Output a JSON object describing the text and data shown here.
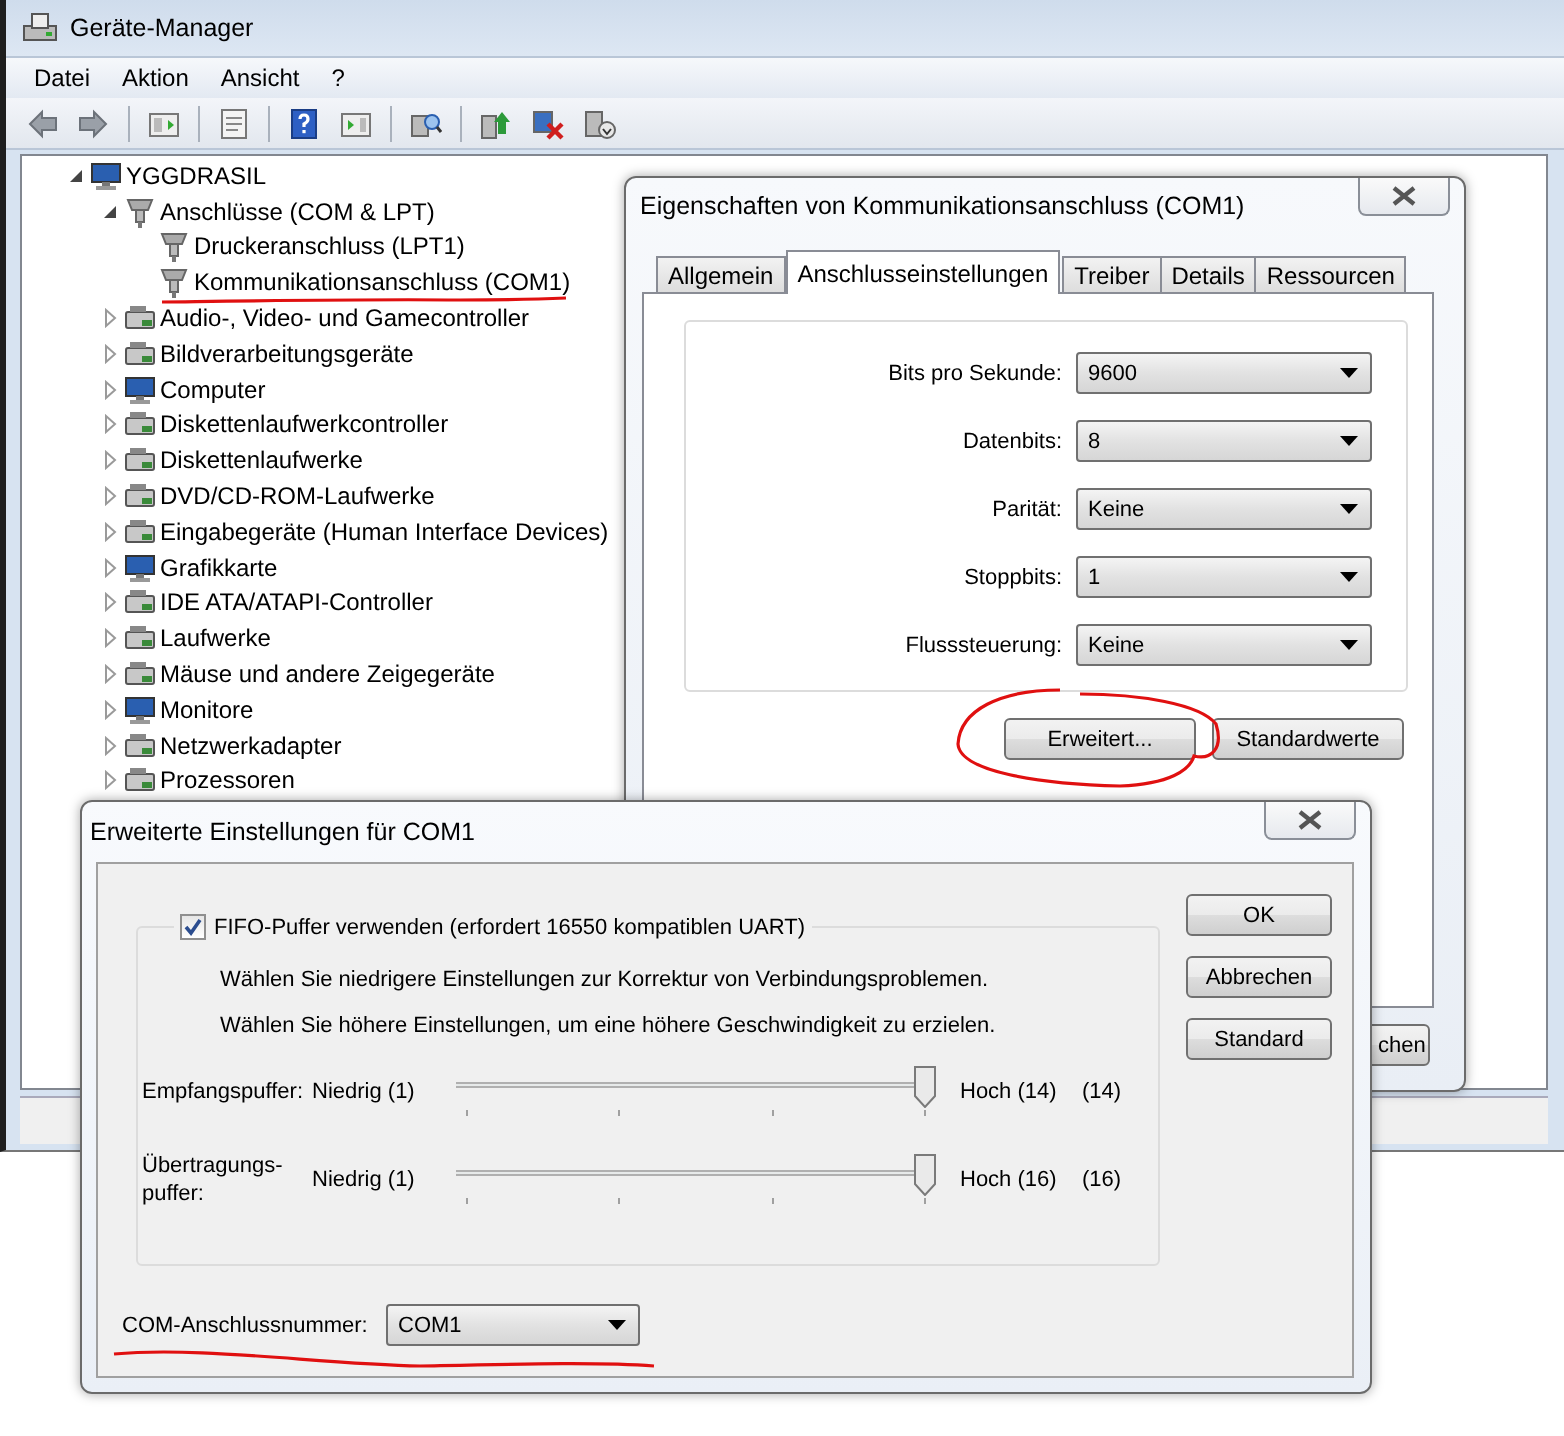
{
  "main_window": {
    "title": "Geräte-Manager",
    "menu": [
      "Datei",
      "Aktion",
      "Ansicht",
      "?"
    ],
    "tree": [
      {
        "label": "YGGDRASIL",
        "kind": "computer",
        "expanded": true,
        "children": [
          {
            "label": "Anschlüsse (COM & LPT)",
            "kind": "port",
            "expanded": true,
            "children": [
              {
                "label": "Druckeranschluss (LPT1)",
                "kind": "port"
              },
              {
                "label": "Kommunikationsanschluss (COM1)",
                "kind": "port"
              }
            ]
          },
          {
            "label": "Audio-, Video- und Gamecontroller",
            "kind": "device",
            "expanded": false
          },
          {
            "label": "Bildverarbeitungsgeräte",
            "kind": "device",
            "expanded": false
          },
          {
            "label": "Computer",
            "kind": "computer",
            "expanded": false
          },
          {
            "label": "Diskettenlaufwerkcontroller",
            "kind": "device",
            "expanded": false
          },
          {
            "label": "Diskettenlaufwerke",
            "kind": "device",
            "expanded": false
          },
          {
            "label": "DVD/CD-ROM-Laufwerke",
            "kind": "device",
            "expanded": false
          },
          {
            "label": "Eingabegeräte (Human Interface Devices)",
            "kind": "device",
            "expanded": false
          },
          {
            "label": "Grafikkarte",
            "kind": "computer",
            "expanded": false
          },
          {
            "label": "IDE ATA/ATAPI-Controller",
            "kind": "device",
            "expanded": false
          },
          {
            "label": "Laufwerke",
            "kind": "device",
            "expanded": false
          },
          {
            "label": "Mäuse und andere Zeigegeräte",
            "kind": "device",
            "expanded": false
          },
          {
            "label": "Monitore",
            "kind": "computer",
            "expanded": false
          },
          {
            "label": "Netzwerkadapter",
            "kind": "device",
            "expanded": false
          },
          {
            "label": "Prozessoren",
            "kind": "device",
            "expanded": false
          }
        ]
      }
    ]
  },
  "properties_dialog": {
    "title": "Eigenschaften von Kommunikationsanschluss (COM1)",
    "tabs": [
      {
        "label": "Allgemein",
        "selected": false
      },
      {
        "label": "Anschlusseinstellungen",
        "selected": true
      },
      {
        "label": "Treiber",
        "selected": false
      },
      {
        "label": "Details",
        "selected": false
      },
      {
        "label": "Ressourcen",
        "selected": false
      }
    ],
    "settings": [
      {
        "label": "Bits pro Sekunde:",
        "value": "9600"
      },
      {
        "label": "Datenbits:",
        "value": "8"
      },
      {
        "label": "Parität:",
        "value": "Keine"
      },
      {
        "label": "Stoppbits:",
        "value": "1"
      },
      {
        "label": "Flusssteuerung:",
        "value": "Keine"
      }
    ],
    "buttons": [
      "Erweitert...",
      "Standardwerte"
    ],
    "covered_button": "chen"
  },
  "advanced_dialog": {
    "title": "Erweiterte Einstellungen für COM1",
    "fifo": {
      "label": "FIFO-Puffer verwenden (erfordert 16550 kompatiblen UART)",
      "checked": true
    },
    "hints": [
      "Wählen Sie niedrigere Einstellungen zur Korrektur von Verbindungsproblemen.",
      "Wählen Sie höhere Einstellungen, um eine höhere Geschwindigkeit zu erzielen."
    ],
    "sliders": [
      {
        "label": "Empfangspuffer:",
        "low": "Niedrig (1)",
        "high": "Hoch (14)",
        "reading": "(14)",
        "level": 1
      },
      {
        "label": "Übertragungs-puffer:",
        "low": "Niedrig (1)",
        "high": "Hoch (16)",
        "reading": "(16)",
        "level": 1
      }
    ],
    "com_port": {
      "label": "COM-Anschlussnummer:",
      "value": "COM1"
    },
    "buttons": [
      "OK",
      "Abbrechen",
      "Standard"
    ]
  }
}
